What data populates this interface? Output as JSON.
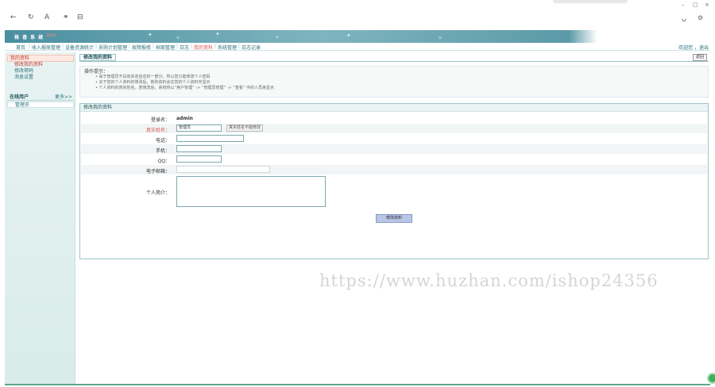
{
  "browser": {
    "back": "←",
    "refresh": "↻",
    "reader": "A",
    "extensions": "⚭",
    "tabs_icon": "⊟",
    "win_minimize": "–",
    "win_restore": "▢",
    "win_close": "×",
    "share": "⍽",
    "settings": "⚙"
  },
  "app": {
    "title": "格 香 系 统",
    "tag": "2022"
  },
  "topnav": {
    "items": [
      {
        "label": "首页"
      },
      {
        "label": "收入报账管理"
      },
      {
        "label": "设备资源统计"
      },
      {
        "label": "采购计划管理"
      },
      {
        "label": "故障报修"
      },
      {
        "label": "档案管理"
      },
      {
        "label": "日志"
      },
      {
        "label": "我的资料",
        "active": true
      },
      {
        "label": "系统管理"
      },
      {
        "label": "日志记录"
      }
    ],
    "user": "欢迎您 ，退出"
  },
  "sidebar": {
    "group_title": "我的资料",
    "items": [
      {
        "label": "修改我的资料",
        "current": true
      },
      {
        "label": "修改密码"
      },
      {
        "label": "消息设置"
      }
    ],
    "online_title": "在线用户",
    "online_more": "更多>>",
    "online_users": [
      "管理员"
    ]
  },
  "main": {
    "tab_label": "修改我的资料",
    "back_label": "返回",
    "tips": {
      "title": "操作提示：",
      "lines": [
        "• 由于管理员不具有实名信息的一部分，所以您只能修改个人密码",
        "• 关于您的个人资料的修改后，新的资料会在您的个人资料中显示",
        "• 个人资料的真实姓名，若修改后，系统将以“用户管理” -> “管理员管理” -> “查看” 中的人员来显示"
      ]
    },
    "form": {
      "title": "修改我的资料",
      "fields": [
        {
          "label": "登录名：",
          "value": "admin"
        },
        {
          "label": "真实姓名：",
          "value": "管理员",
          "note": "真实姓名不能修改",
          "required": true
        },
        {
          "label": "电话：",
          "value": ""
        },
        {
          "label": "手机：",
          "value": ""
        },
        {
          "label": "QQ：",
          "value": ""
        },
        {
          "label": "电子邮箱：",
          "value": ""
        },
        {
          "label": "个人简介：",
          "value": ""
        }
      ],
      "submit_label": "修改资料"
    }
  },
  "watermark": "https://www.huzhan.com/ishop24356"
}
